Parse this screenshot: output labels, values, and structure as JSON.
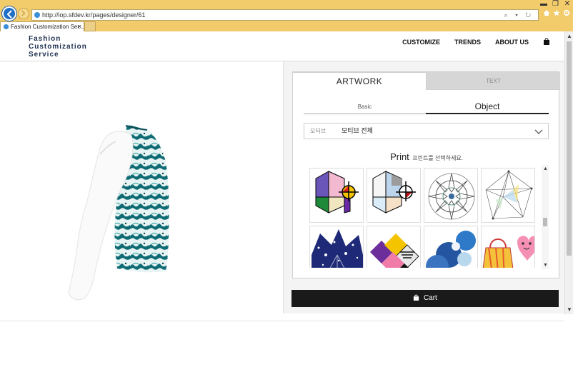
{
  "browser": {
    "url": "http://iop.sfdev.kr/pages/designer/61",
    "tab_title": "Fashion Customization Ser...",
    "tab_close": "×",
    "address_tools": "⌕ ▾ ↻"
  },
  "site": {
    "logo": [
      "Fashion",
      "Customization",
      "Service"
    ],
    "menu": [
      "CUSTOMIZE",
      "TRENDS",
      "ABOUT US"
    ]
  },
  "panel": {
    "tabs": {
      "artwork": "ARTWORK",
      "text": "TEXT"
    },
    "sub_tabs": {
      "basic": "Basic",
      "object": "Object"
    },
    "motif": {
      "label": "모티브",
      "value": "모티브 전체"
    },
    "print": {
      "title": "Print",
      "subtitle": "프린트를 선택하세요."
    }
  },
  "cart": {
    "label": "Cart"
  },
  "colors": {
    "chrome": "#f2cb6a",
    "cart_bg": "#1a1a1a",
    "teal_print": "#0e6b73"
  }
}
